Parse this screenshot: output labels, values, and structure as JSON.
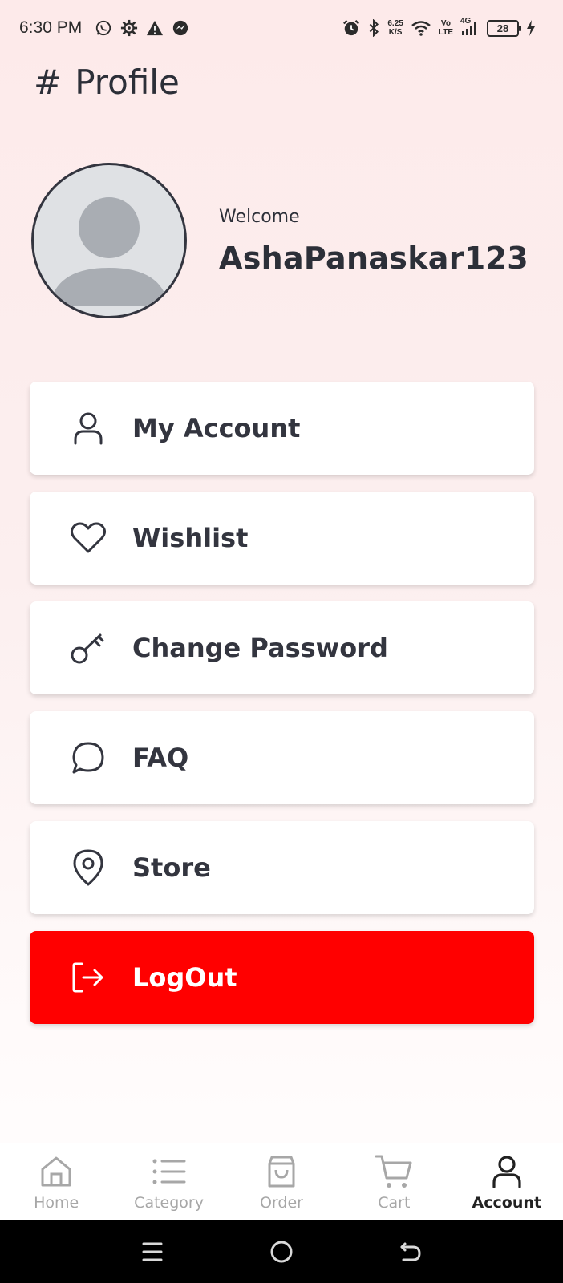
{
  "status_bar": {
    "time": "6:30 PM",
    "net_speed_value": "6.25",
    "net_speed_unit": "K/S",
    "volte_top": "Vo",
    "volte_bottom": "LTE",
    "network": "4G",
    "battery": "28"
  },
  "header": {
    "title": "Profile"
  },
  "profile": {
    "welcome": "Welcome",
    "username": "AshaPanaskar123"
  },
  "menu": {
    "items": [
      {
        "label": "My Account",
        "icon": "user-icon"
      },
      {
        "label": "Wishlist",
        "icon": "heart-icon"
      },
      {
        "label": "Change Password",
        "icon": "key-icon"
      },
      {
        "label": "FAQ",
        "icon": "chat-bubble-icon"
      },
      {
        "label": "Store",
        "icon": "location-pin-icon"
      }
    ],
    "logout": {
      "label": "LogOut",
      "icon": "logout-icon",
      "color": "#ff0000"
    }
  },
  "bottom_nav": {
    "items": [
      {
        "label": "Home",
        "icon": "home-icon"
      },
      {
        "label": "Category",
        "icon": "list-icon"
      },
      {
        "label": "Order",
        "icon": "shopping-bag-icon"
      },
      {
        "label": "Cart",
        "icon": "cart-icon"
      },
      {
        "label": "Account",
        "icon": "user-icon",
        "active": true
      }
    ]
  }
}
